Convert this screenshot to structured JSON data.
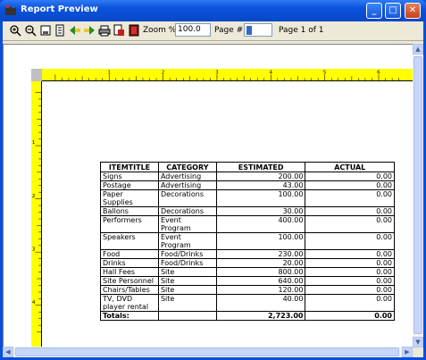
{
  "window": {
    "title": "Report Preview"
  },
  "toolbar": {
    "zoom_label": "Zoom %",
    "zoom_value": "100.0",
    "page_label": "Page #",
    "page_value": "1",
    "page_count": "Page 1 of 1",
    "tools": [
      "zoom-in-icon",
      "zoom-out-icon",
      "fit-page-icon",
      "page-view-icon",
      "previous-page-icon",
      "next-page-icon",
      "print-icon",
      "export-icon",
      "close-preview-icon"
    ]
  },
  "rulers": {
    "horizontal": [
      "1",
      "2",
      "3",
      "4",
      "5",
      "6"
    ],
    "vertical": [
      "1",
      "2",
      "3",
      "4"
    ]
  },
  "report": {
    "headers": [
      "ITEMTITLE",
      "CATEGORY",
      "ESTIMATED",
      "ACTUAL"
    ],
    "rows": [
      {
        "item": "Signs",
        "category": "Advertising",
        "estimated": "200.00",
        "actual": "0.00"
      },
      {
        "item": "Postage",
        "category": "Advertising",
        "estimated": "43.00",
        "actual": "0.00"
      },
      {
        "item": "Paper\nSupplies",
        "category": "Decorations",
        "estimated": "100.00",
        "actual": "0.00"
      },
      {
        "item": "Ballons",
        "category": "Decorations",
        "estimated": "30.00",
        "actual": "0.00"
      },
      {
        "item": "Performers",
        "category": "Event\nProgram",
        "estimated": "400.00",
        "actual": "0.00"
      },
      {
        "item": "Speakers",
        "category": "Event\nProgram",
        "estimated": "100.00",
        "actual": "0.00"
      },
      {
        "item": "Food",
        "category": "Food/Drinks",
        "estimated": "230.00",
        "actual": "0.00"
      },
      {
        "item": "Drinks",
        "category": "Food/Drinks",
        "estimated": "20.00",
        "actual": "0.00"
      },
      {
        "item": "Hall Fees",
        "category": "Site",
        "estimated": "800.00",
        "actual": "0.00"
      },
      {
        "item": "Site Personnel",
        "category": "Site",
        "estimated": "640.00",
        "actual": "0.00"
      },
      {
        "item": "Chairs/Tables",
        "category": "Site",
        "estimated": "120.00",
        "actual": "0.00"
      },
      {
        "item": "TV, DVD\nplayer rental",
        "category": "Site",
        "estimated": "40.00",
        "actual": "0.00"
      }
    ],
    "totals": {
      "label": "Totals:",
      "estimated": "2,723.00",
      "actual": "0.00"
    }
  },
  "colors": {
    "ruler": "#ffff00",
    "titlebar": "#0a52dc",
    "close_button": "#c8401a"
  }
}
